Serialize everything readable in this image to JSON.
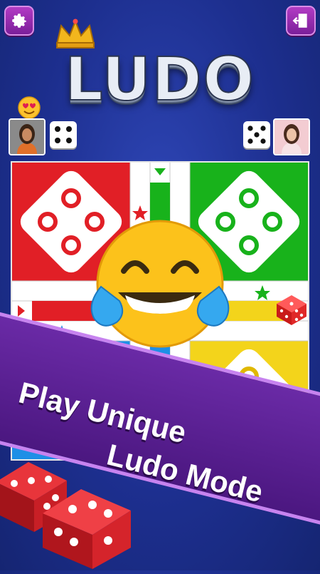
{
  "header": {
    "settings_icon": "gear-icon",
    "exit_icon": "exit-door-icon",
    "logo_text": "LUDO",
    "crown_icon": "crown-icon"
  },
  "players": {
    "left": {
      "avatar": "woman-avatar",
      "reaction": "heart-eyes-emoji",
      "dice_face": 4
    },
    "right": {
      "avatar": "woman-avatar",
      "dice_face": 5
    }
  },
  "board": {
    "homes": [
      {
        "color": "red",
        "hex": "#e11f26"
      },
      {
        "color": "green",
        "hex": "#18b21b"
      },
      {
        "color": "blue",
        "hex": "#1e8fe6"
      },
      {
        "color": "yellow",
        "hex": "#f3d41b"
      }
    ],
    "center_emoji": "tears-of-joy-emoji"
  },
  "banner": {
    "line1": "Play Unique",
    "line2": "Ludo Mode"
  },
  "colors": {
    "background": "#1d2f8f",
    "banner": "#5a1f94",
    "button": "#9b2fb3"
  }
}
